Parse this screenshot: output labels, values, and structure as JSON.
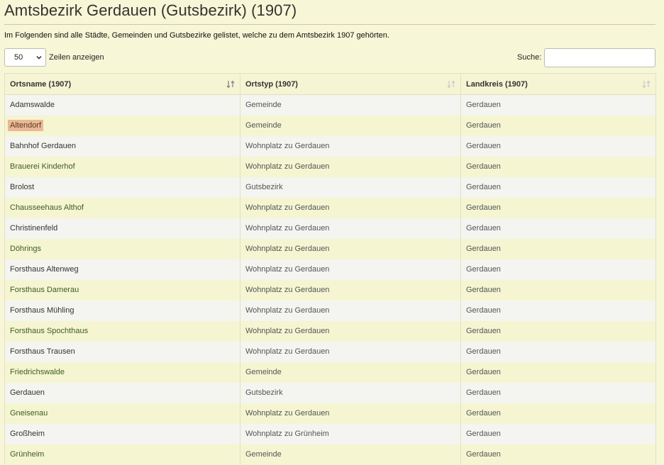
{
  "page": {
    "title": "Amtsbezirk Gerdauen (Gutsbezirk) (1907)",
    "intro": "Im Folgenden sind alle Städte, Gemeinden und Gutsbezirke gelistet, welche zu dem Amtsbezirk 1907 gehörten."
  },
  "controls": {
    "length_value": "50",
    "length_label": "Zeilen anzeigen",
    "search_label": "Suche:",
    "search_value": ""
  },
  "table": {
    "headers": [
      "Ortsname (1907)",
      "Ortstyp (1907)",
      "Landkreis (1907)"
    ],
    "sort_icon": "sort-arrows-icon",
    "rows": [
      [
        "Adamswalde",
        "Gemeinde",
        "Gerdauen"
      ],
      [
        "Altendorf",
        "Gemeinde",
        "Gerdauen"
      ],
      [
        "Bahnhof Gerdauen",
        "Wohnplatz zu Gerdauen",
        "Gerdauen"
      ],
      [
        "Brauerei Kinderhof",
        "Wohnplatz zu Gerdauen",
        "Gerdauen"
      ],
      [
        "Brolost",
        "Gutsbezirk",
        "Gerdauen"
      ],
      [
        "Chausseehaus Althof",
        "Wohnplatz zu Gerdauen",
        "Gerdauen"
      ],
      [
        "Christinenfeld",
        "Wohnplatz zu Gerdauen",
        "Gerdauen"
      ],
      [
        "Döhrings",
        "Wohnplatz zu Gerdauen",
        "Gerdauen"
      ],
      [
        "Forsthaus Altenweg",
        "Wohnplatz zu Gerdauen",
        "Gerdauen"
      ],
      [
        "Forsthaus Damerau",
        "Wohnplatz zu Gerdauen",
        "Gerdauen"
      ],
      [
        "Forsthaus Mühling",
        "Wohnplatz zu Gerdauen",
        "Gerdauen"
      ],
      [
        "Forsthaus Spochthaus",
        "Wohnplatz zu Gerdauen",
        "Gerdauen"
      ],
      [
        "Forsthaus Trausen",
        "Wohnplatz zu Gerdauen",
        "Gerdauen"
      ],
      [
        "Friedrichswalde",
        "Gemeinde",
        "Gerdauen"
      ],
      [
        "Gerdauen",
        "Gutsbezirk",
        "Gerdauen"
      ],
      [
        "Gneisenau",
        "Wohnplatz zu Gerdauen",
        "Gerdauen"
      ],
      [
        "Großheim",
        "Wohnplatz zu Grünheim",
        "Gerdauen"
      ],
      [
        "Grünheim",
        "Gemeinde",
        "Gerdauen"
      ]
    ],
    "highlighted_row": 1
  },
  "colors": {
    "background": "#f7f6d6",
    "row_alt": "#f5f5d2",
    "row": "#f4f4f0",
    "link": "#3f5b1e",
    "highlight": "#eab797"
  }
}
